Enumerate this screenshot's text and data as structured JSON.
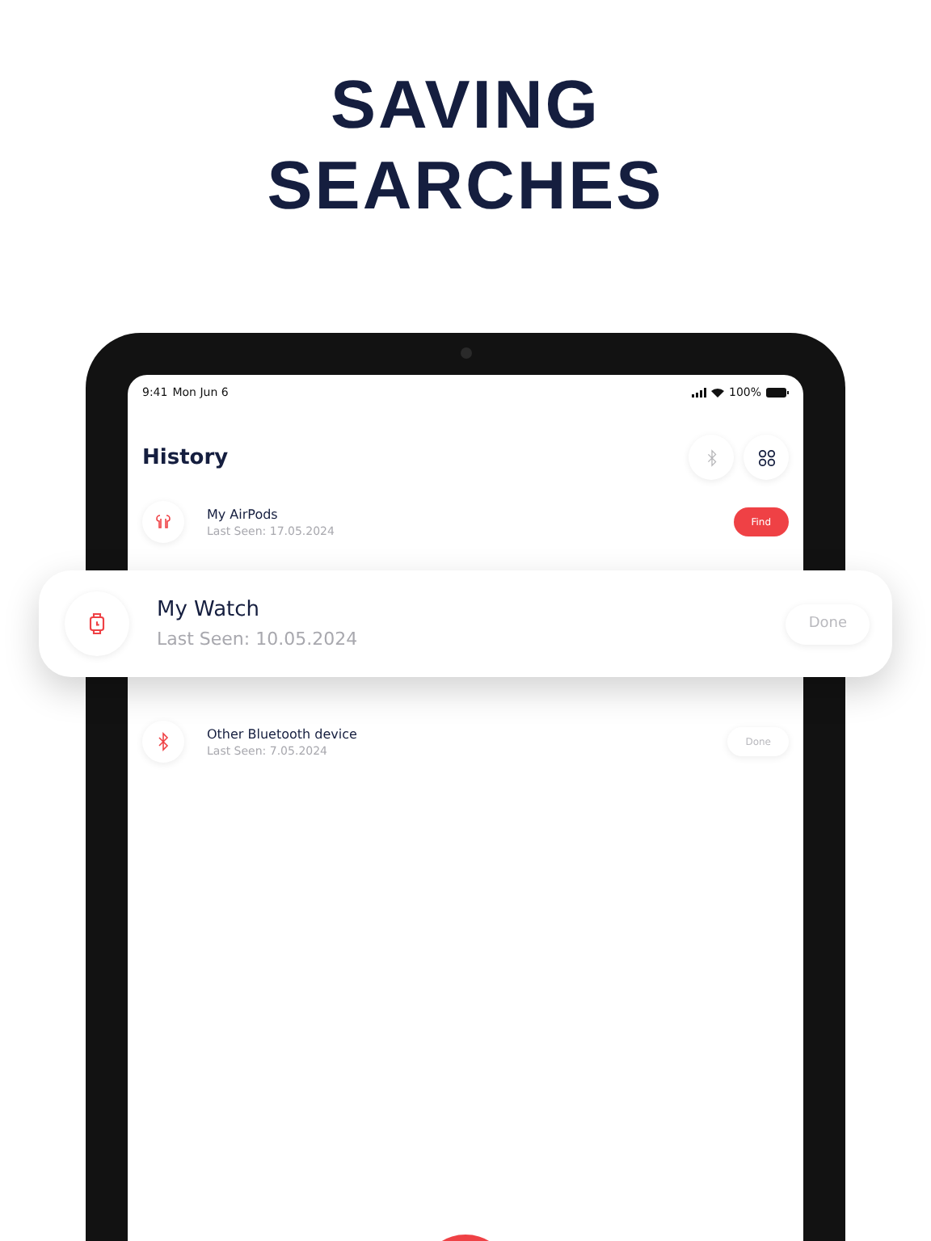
{
  "headline": [
    "SAVING",
    "SEARCHES"
  ],
  "status_bar": {
    "time": "9:41",
    "date": "Mon Jun 6",
    "battery": "100%"
  },
  "screen": {
    "title": "History"
  },
  "devices": [
    {
      "name": "My AirPods",
      "last_seen": "Last Seen: 17.05.2024",
      "kind": "earbuds",
      "action": {
        "label": "Find",
        "kind": "primary"
      }
    },
    {
      "name": "Other Bluetooth device",
      "last_seen": "Last Seen: 7.05.2024",
      "kind": "bluetooth",
      "action": {
        "label": "Done",
        "kind": "muted"
      }
    }
  ],
  "floating_card": {
    "name": "My Watch",
    "last_seen": "Last Seen: 10.05.2024",
    "kind": "watch",
    "action": {
      "label": "Done",
      "kind": "muted"
    }
  }
}
